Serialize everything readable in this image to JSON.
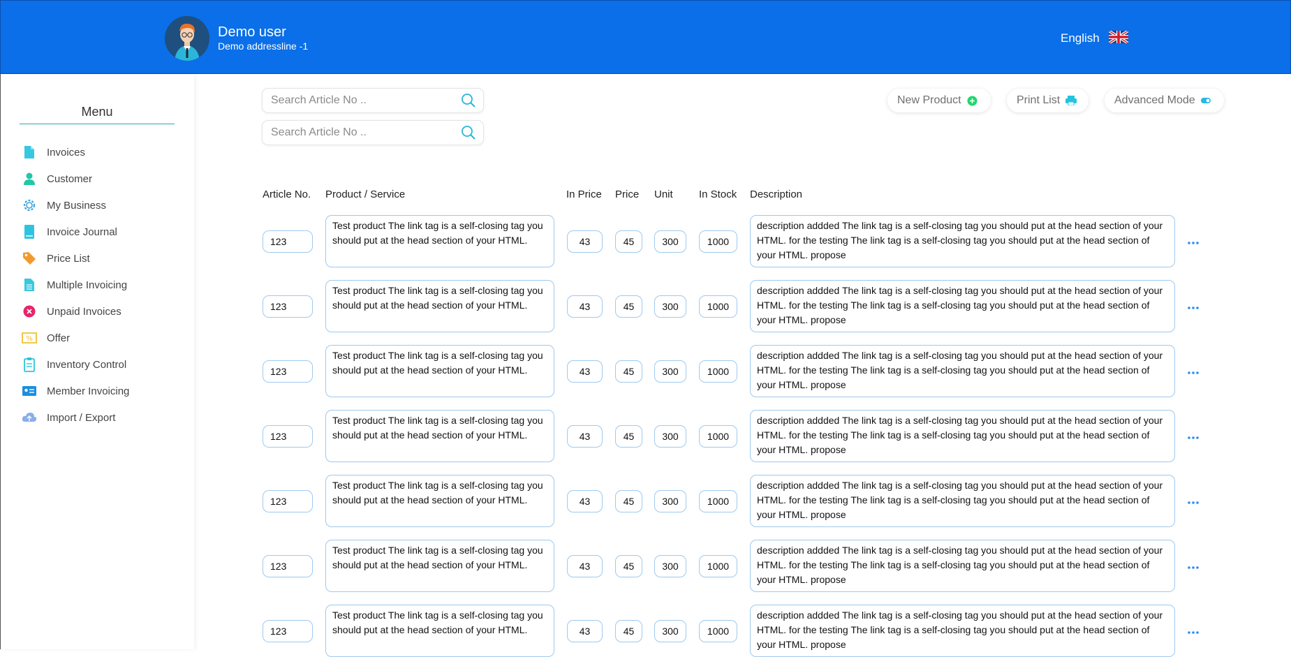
{
  "header": {
    "user_name": "Demo user",
    "user_address": "Demo addressline -1",
    "language": "English",
    "brand_color": "#0a6fe8"
  },
  "sidebar": {
    "title": "Menu",
    "items": [
      {
        "label": "Invoices",
        "icon": "document-icon",
        "color": "#37c8e0"
      },
      {
        "label": "Customer",
        "icon": "person-icon",
        "color": "#1ec8a8"
      },
      {
        "label": "My Business",
        "icon": "gear-icon",
        "color": "#3aa3e0"
      },
      {
        "label": "Invoice Journal",
        "icon": "book-icon",
        "color": "#2ec4df"
      },
      {
        "label": "Price List",
        "icon": "price-tag-icon",
        "color": "#f29a2e"
      },
      {
        "label": "Multiple Invoicing",
        "icon": "documents-icon",
        "color": "#37c8e0"
      },
      {
        "label": "Unpaid Invoices",
        "icon": "x-circle-icon",
        "color": "#e8246a"
      },
      {
        "label": "Offer",
        "icon": "percent-tag-icon",
        "color": "#f2c12e"
      },
      {
        "label": "Inventory Control",
        "icon": "clipboard-icon",
        "color": "#2ec4df"
      },
      {
        "label": "Member Invoicing",
        "icon": "id-card-icon",
        "color": "#1a8fe0"
      },
      {
        "label": "Import / Export",
        "icon": "cloud-icon",
        "color": "#8aaee8"
      }
    ]
  },
  "search": [
    {
      "placeholder": "Search Article No .."
    },
    {
      "placeholder": "Search Article No .."
    }
  ],
  "toolbar": {
    "new_product": "New Product",
    "print_list": "Print List",
    "advanced_mode": "Advanced Mode"
  },
  "table": {
    "headers": [
      "Article No.",
      "Product / Service",
      "In Price",
      "Price",
      "Unit",
      "In Stock",
      "Description"
    ],
    "rows": [
      {
        "article": "123",
        "product": "Test product The link tag is a self-closing tag you should put at the head section of your HTML.",
        "in_price": "43",
        "price": "45",
        "unit": "300",
        "stock": "1000",
        "description": "description addded The link tag is a self-closing tag you should put at the head section of your HTML. for the testing The link tag is a self-closing tag you should put at the head section of your HTML. propose"
      },
      {
        "article": "123",
        "product": "Test product The link tag is a self-closing tag you should put at the head section of your HTML.",
        "in_price": "43",
        "price": "45",
        "unit": "300",
        "stock": "1000",
        "description": "description addded The link tag is a self-closing tag you should put at the head section of your HTML. for the testing The link tag is a self-closing tag you should put at the head section of your HTML. propose"
      },
      {
        "article": "123",
        "product": "Test product The link tag is a self-closing tag you should put at the head section of your HTML.",
        "in_price": "43",
        "price": "45",
        "unit": "300",
        "stock": "1000",
        "description": "description addded The link tag is a self-closing tag you should put at the head section of your HTML. for the testing The link tag is a self-closing tag you should put at the head section of your HTML. propose"
      },
      {
        "article": "123",
        "product": "Test product The link tag is a self-closing tag you should put at the head section of your HTML.",
        "in_price": "43",
        "price": "45",
        "unit": "300",
        "stock": "1000",
        "description": "description addded The link tag is a self-closing tag you should put at the head section of your HTML. for the testing The link tag is a self-closing tag you should put at the head section of your HTML. propose"
      },
      {
        "article": "123",
        "product": "Test product The link tag is a self-closing tag you should put at the head section of your HTML.",
        "in_price": "43",
        "price": "45",
        "unit": "300",
        "stock": "1000",
        "description": "description addded The link tag is a self-closing tag you should put at the head section of your HTML. for the testing The link tag is a self-closing tag you should put at the head section of your HTML. propose"
      },
      {
        "article": "123",
        "product": "Test product The link tag is a self-closing tag you should put at the head section of your HTML.",
        "in_price": "43",
        "price": "45",
        "unit": "300",
        "stock": "1000",
        "description": "description addded The link tag is a self-closing tag you should put at the head section of your HTML. for the testing The link tag is a self-closing tag you should put at the head section of your HTML. propose"
      },
      {
        "article": "123",
        "product": "Test product The link tag is a self-closing tag you should put at the head section of your HTML.",
        "in_price": "43",
        "price": "45",
        "unit": "300",
        "stock": "1000",
        "description": "description addded The link tag is a self-closing tag you should put at the head section of your HTML. for the testing The link tag is a self-closing tag you should put at the head section of your HTML. propose"
      }
    ]
  }
}
